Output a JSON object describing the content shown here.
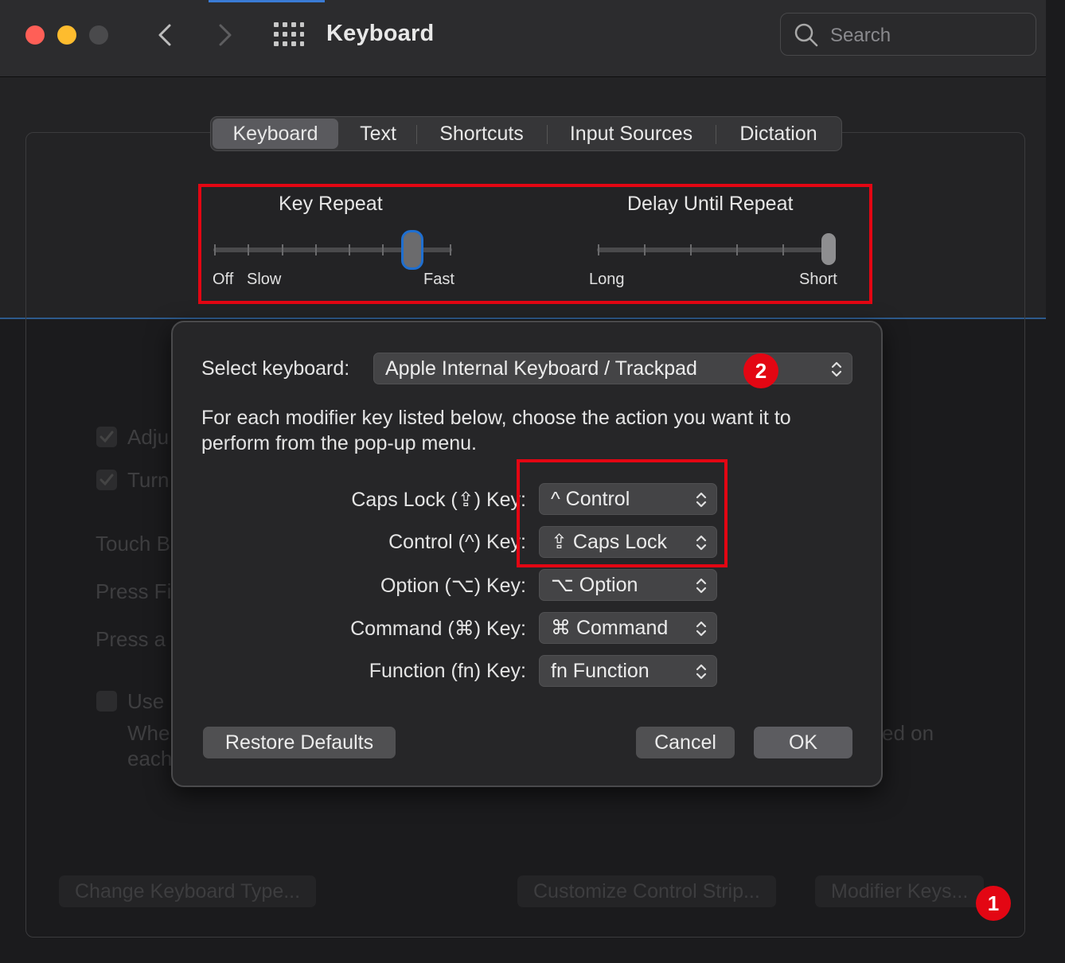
{
  "window": {
    "title": "Keyboard",
    "search_placeholder": "Search"
  },
  "tabs": [
    {
      "label": "Keyboard",
      "active": true
    },
    {
      "label": "Text"
    },
    {
      "label": "Shortcuts"
    },
    {
      "label": "Input Sources"
    },
    {
      "label": "Dictation"
    }
  ],
  "key_repeat": {
    "title": "Key Repeat",
    "labels": [
      "Off",
      "Slow",
      "Fast"
    ],
    "ticks": 8,
    "selected_index": 6
  },
  "delay_until_repeat": {
    "title": "Delay Until Repeat",
    "labels": [
      "Long",
      "Short"
    ],
    "ticks": 6,
    "selected_index": 5
  },
  "background": {
    "rows": [
      "Adju",
      "Turn",
      "Touch B",
      "Press Fi",
      "Press a",
      "Use",
      "Whe",
      "each"
    ],
    "suffix": "ed on",
    "buttons": [
      "Change Keyboard Type...",
      "Customize Control Strip...",
      "Modifier Keys..."
    ]
  },
  "sheet": {
    "select_label": "Select keyboard:",
    "keyboard_value": "Apple Internal Keyboard / Trackpad",
    "instruction_line1": "For each modifier key listed below, choose the action you want it to",
    "instruction_line2": "perform from the pop-up menu.",
    "modifiers": [
      {
        "label": "Caps Lock (⇪) Key:",
        "value": "^ Control"
      },
      {
        "label": "Control (^) Key:",
        "value": "⇪ Caps Lock"
      },
      {
        "label": "Option (⌥) Key:",
        "value": "⌥ Option"
      },
      {
        "label": "Command (⌘) Key:",
        "value": "⌘ Command"
      },
      {
        "label": "Function (fn) Key:",
        "value": "fn Function"
      }
    ],
    "restore_label": "Restore Defaults",
    "cancel_label": "Cancel",
    "ok_label": "OK"
  },
  "badges": [
    "1",
    "2"
  ],
  "colors": {
    "annotation_red": "#e30613",
    "accent_blue": "#3a7bd5"
  }
}
